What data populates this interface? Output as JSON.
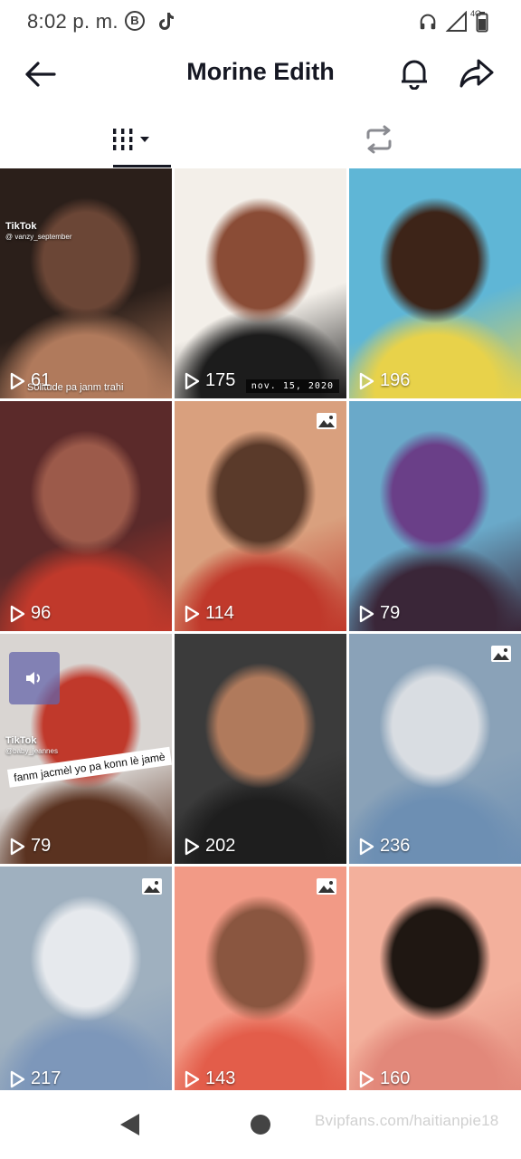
{
  "status_bar": {
    "time": "8:02 p. m.",
    "b_badge": "B",
    "network": "4G",
    "icons": [
      "b-icon",
      "tiktok-icon",
      "headphones-icon",
      "signal-icon",
      "battery-icon"
    ]
  },
  "header": {
    "title": "Morine Edith",
    "icons": [
      "back-arrow-icon",
      "bell-icon",
      "share-arrow-icon"
    ]
  },
  "tabs": [
    {
      "name": "videos",
      "icon": "grid-columns-icon",
      "selected": true
    },
    {
      "name": "reposts",
      "icon": "repost-icon",
      "selected": false
    }
  ],
  "videos": [
    {
      "views": "61",
      "watermark": "TikTok",
      "handle": "@ vanzy_september",
      "overlay": "Solitude pa janm trahi",
      "colors": [
        "#2b1f1a",
        "#6b4636",
        "#b07a5c"
      ]
    },
    {
      "views": "175",
      "date_stamp": "nov. 15, 2020",
      "colors": [
        "#f3efe9",
        "#8a4c36",
        "#1c1c1c"
      ]
    },
    {
      "views": "196",
      "colors": [
        "#5fb6d6",
        "#3d2418",
        "#e8d24a"
      ]
    },
    {
      "views": "96",
      "colors": [
        "#5b2a2a",
        "#9c5a4a",
        "#c0392b"
      ]
    },
    {
      "views": "114",
      "photo": true,
      "colors": [
        "#d9a07e",
        "#5a3a2a",
        "#c0392b"
      ]
    },
    {
      "views": "79",
      "colors": [
        "#6aa9c9",
        "#6a3f88",
        "#3a2638"
      ]
    },
    {
      "views": "79",
      "watermark": "TikTok",
      "handle": "@baby_jeannes",
      "caption": "fanm jacmèl yo pa konn lè jamè",
      "colors": [
        "#d9d5d2",
        "#c0392b",
        "#5a3220"
      ]
    },
    {
      "views": "202",
      "colors": [
        "#3b3b3b",
        "#b07a5c",
        "#1e1e1e"
      ]
    },
    {
      "views": "236",
      "photo": true,
      "colors": [
        "#8aa2b8",
        "#d9dde2",
        "#6d8fb3"
      ]
    },
    {
      "views": "217",
      "photo": true,
      "colors": [
        "#9fb0bf",
        "#e6e9ed",
        "#7d97ba"
      ]
    },
    {
      "views": "143",
      "photo": true,
      "colors": [
        "#f29a86",
        "#8a5640",
        "#e35d4a"
      ]
    },
    {
      "views": "160",
      "colors": [
        "#f3b09c",
        "#1f1712",
        "#e2887a"
      ]
    },
    {
      "colors": [
        "#d8cfc8",
        "#3a2a22",
        "#a07060"
      ]
    },
    {
      "colors": [
        "#e6e2de",
        "#cfc7c1",
        "#bbb2aa"
      ]
    },
    {
      "colors": [
        "#e2ddd8",
        "#c9bfb8",
        "#b3a8a0"
      ]
    }
  ],
  "nav": {
    "watermark": "Bvipfans.com/haitianpie18",
    "icons": [
      "nav-back-icon",
      "nav-home-icon"
    ]
  }
}
